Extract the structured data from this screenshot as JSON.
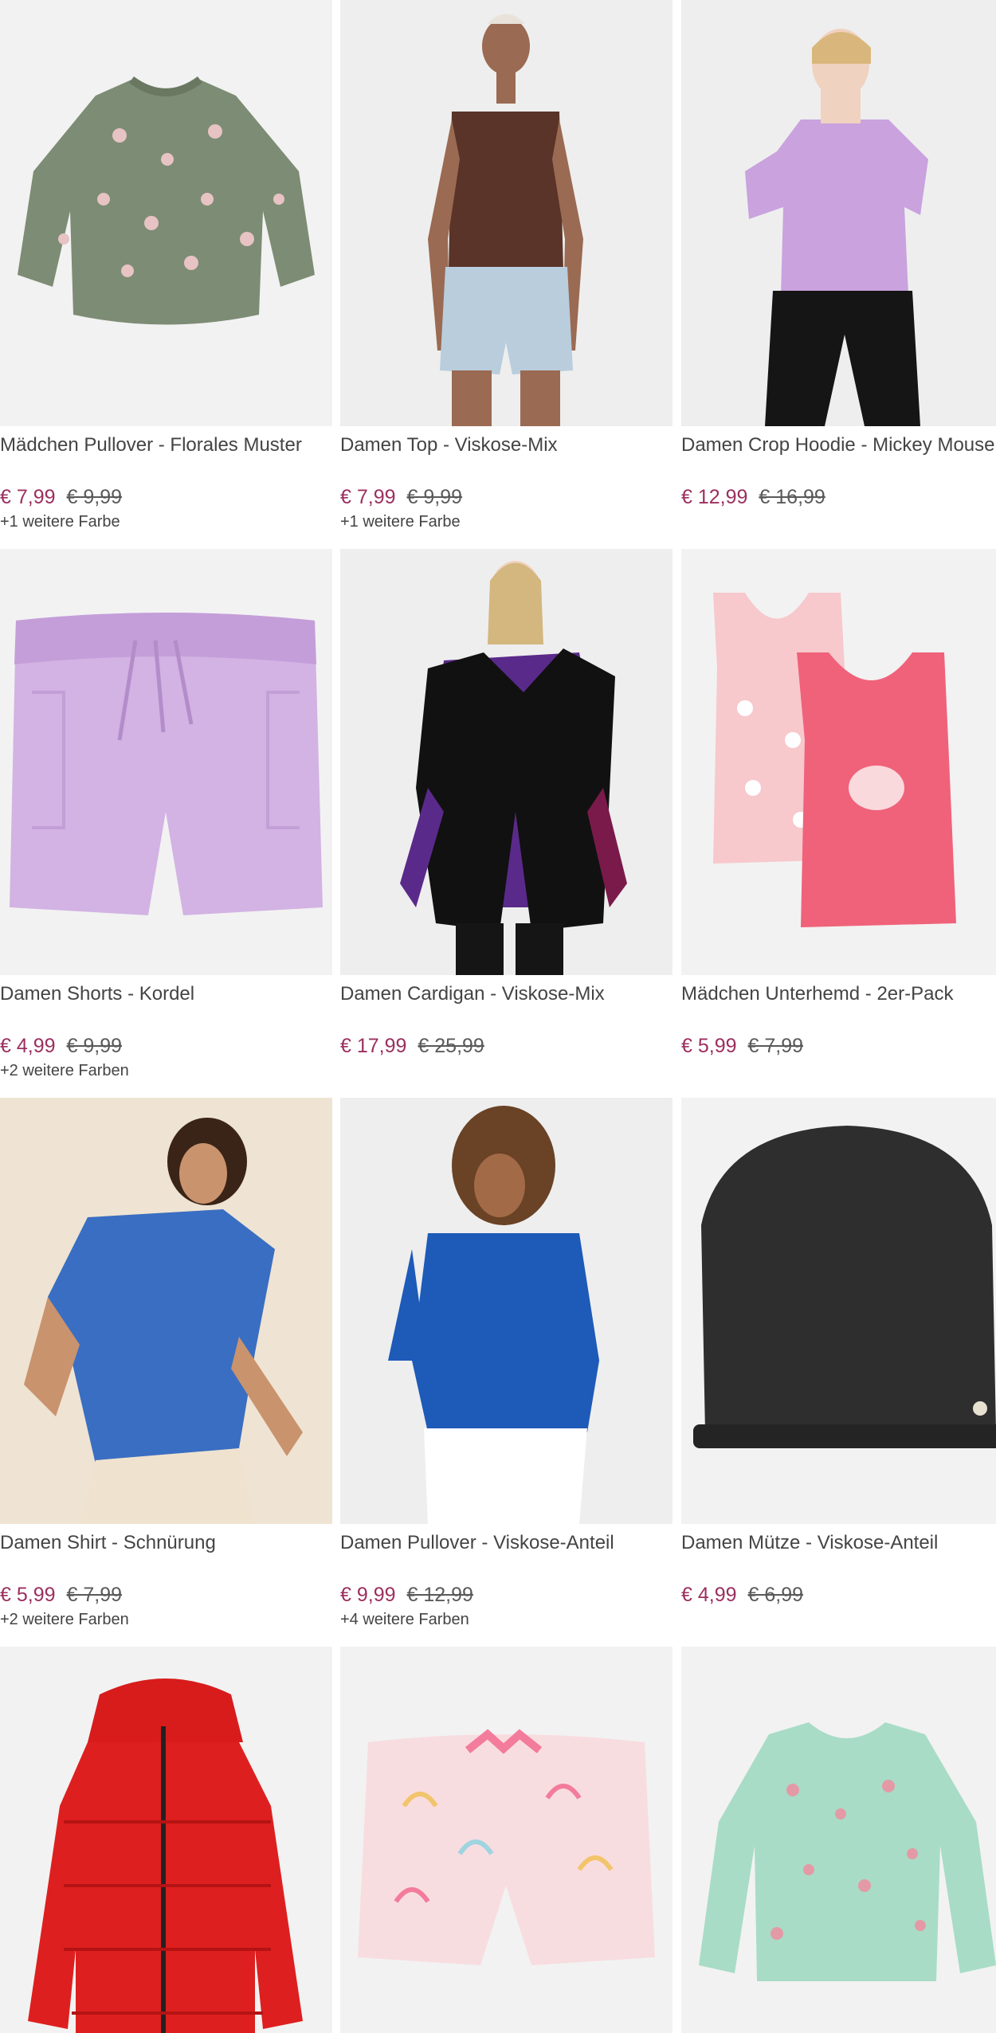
{
  "products": [
    {
      "title": "Mädchen Pullover - Florales Muster",
      "price": "€ 7,99",
      "old_price": "€ 9,99",
      "colors": "+1 weitere Farbe",
      "image": "green-floral-sweater",
      "bg": "#f2f2f2"
    },
    {
      "title": "Damen Top - Viskose-Mix",
      "price": "€ 7,99",
      "old_price": "€ 9,99",
      "colors": "+1 weitere Farbe",
      "image": "brown-top-denim-shorts-model",
      "bg": "#eeeeee"
    },
    {
      "title": "Damen Crop Hoodie - Mickey Mouse",
      "price": "€ 12,99",
      "old_price": "€ 16,99",
      "colors": "",
      "image": "lilac-crop-hoodie-model",
      "bg": "#eeeeee"
    },
    {
      "title": "Damen Shorts - Kordel",
      "price": "€ 4,99",
      "old_price": "€ 9,99",
      "colors": "+2 weitere Farben",
      "image": "lilac-shorts",
      "bg": "#f2f2f2"
    },
    {
      "title": "Damen Cardigan - Viskose-Mix",
      "price": "€ 17,99",
      "old_price": "€ 25,99",
      "colors": "",
      "image": "black-knit-vest-model",
      "bg": "#eeeeee"
    },
    {
      "title": "Mädchen Unterhemd - 2er-Pack",
      "price": "€ 5,99",
      "old_price": "€ 7,99",
      "colors": "",
      "image": "pink-tank-tops-two-pack",
      "bg": "#f2f2f2"
    },
    {
      "title": "Damen Shirt - Schnürung",
      "price": "€ 5,99",
      "old_price": "€ 7,99",
      "colors": "+2 weitere Farben",
      "image": "blue-shirt-model",
      "bg": "#efe3d3"
    },
    {
      "title": "Damen Pullover - Viskose-Anteil",
      "price": "€ 9,99",
      "old_price": "€ 12,99",
      "colors": "+4 weitere Farben",
      "image": "blue-knit-pullover-model",
      "bg": "#eeeeee"
    },
    {
      "title": "Damen Mütze - Viskose-Anteil",
      "price": "€ 4,99",
      "old_price": "€ 6,99",
      "colors": "",
      "image": "black-beanie",
      "bg": "#f2f2f2"
    },
    {
      "title": "",
      "price": "",
      "old_price": "",
      "colors": "",
      "image": "red-puffer-jacket",
      "bg": "#f2f2f2"
    },
    {
      "title": "",
      "price": "",
      "old_price": "",
      "colors": "",
      "image": "pink-rainbow-shorts",
      "bg": "#f2f2f2"
    },
    {
      "title": "",
      "price": "",
      "old_price": "",
      "colors": "",
      "image": "mint-floral-blouse",
      "bg": "#f2f2f2"
    }
  ]
}
